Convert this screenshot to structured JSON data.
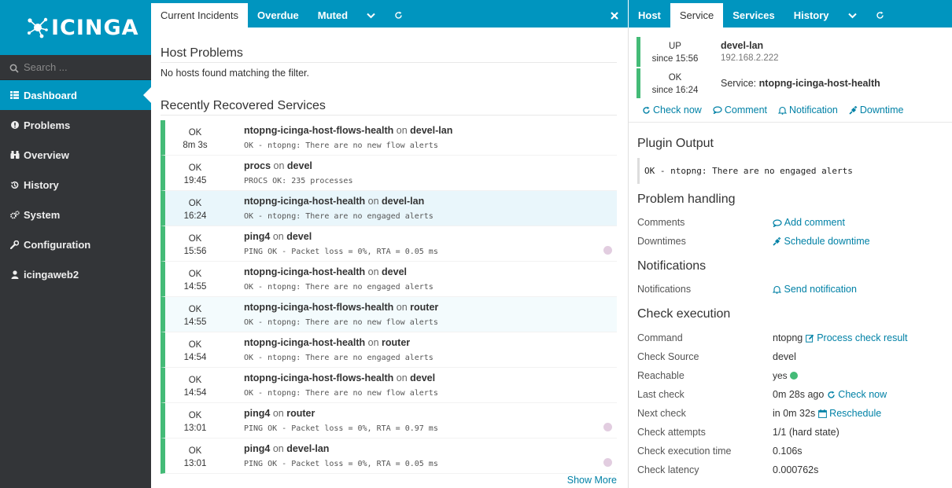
{
  "brand": {
    "name": "ICINGA"
  },
  "search": {
    "placeholder": "Search ..."
  },
  "nav": [
    {
      "label": "Dashboard",
      "icon": "dashboard-icon"
    },
    {
      "label": "Problems",
      "icon": "problems-icon"
    },
    {
      "label": "Overview",
      "icon": "binoculars-icon"
    },
    {
      "label": "History",
      "icon": "history-icon"
    },
    {
      "label": "System",
      "icon": "gears-icon"
    },
    {
      "label": "Configuration",
      "icon": "wrench-icon"
    },
    {
      "label": "icingaweb2",
      "icon": "user-icon"
    }
  ],
  "left_tabs": [
    "Current Incidents",
    "Overdue",
    "Muted"
  ],
  "right_tabs": [
    "Host",
    "Service",
    "Services",
    "History"
  ],
  "host_problems": {
    "title": "Host Problems",
    "empty": "No hosts found matching the filter."
  },
  "recovered": {
    "title": "Recently Recovered Services",
    "on": "on",
    "rows": [
      {
        "state": "OK",
        "time": "8m 3s",
        "service": "ntopng-icinga-host-flows-health",
        "host": "devel-lan",
        "output": "OK - ntopng: There are no new flow alerts"
      },
      {
        "state": "OK",
        "time": "19:45",
        "service": "procs",
        "host": "devel",
        "output": "PROCS OK: 235 processes"
      },
      {
        "state": "OK",
        "time": "16:24",
        "service": "ntopng-icinga-host-health",
        "host": "devel-lan",
        "output": "OK - ntopng: There are no engaged alerts"
      },
      {
        "state": "OK",
        "time": "15:56",
        "service": "ping4",
        "host": "devel",
        "output": "PING OK - Packet loss = 0%, RTA = 0.05 ms"
      },
      {
        "state": "OK",
        "time": "14:55",
        "service": "ntopng-icinga-host-health",
        "host": "devel",
        "output": "OK - ntopng: There are no engaged alerts"
      },
      {
        "state": "OK",
        "time": "14:55",
        "service": "ntopng-icinga-host-flows-health",
        "host": "router",
        "output": "OK - ntopng: There are no new flow alerts"
      },
      {
        "state": "OK",
        "time": "14:54",
        "service": "ntopng-icinga-host-health",
        "host": "router",
        "output": "OK - ntopng: There are no engaged alerts"
      },
      {
        "state": "OK",
        "time": "14:54",
        "service": "ntopng-icinga-host-flows-health",
        "host": "devel",
        "output": "OK - ntopng: There are no new flow alerts"
      },
      {
        "state": "OK",
        "time": "13:01",
        "service": "ping4",
        "host": "router",
        "output": "PING OK - Packet loss = 0%, RTA = 0.97 ms"
      },
      {
        "state": "OK",
        "time": "13:01",
        "service": "ping4",
        "host": "devel-lan",
        "output": "PING OK - Packet loss = 0%, RTA = 0.05 ms"
      }
    ],
    "show_more": "Show More"
  },
  "detail": {
    "host": {
      "state": "UP",
      "since": "since 15:56",
      "name": "devel-lan",
      "address": "192.168.2.222"
    },
    "service": {
      "state": "OK",
      "since": "since 16:24",
      "prefix": "Service:",
      "name": "ntopng-icinga-host-health"
    },
    "actions": [
      "Check now",
      "Comment",
      "Notification",
      "Downtime"
    ],
    "plugin_output": {
      "title": "Plugin Output",
      "text": "OK - ntopng: There are no engaged alerts"
    },
    "problem_handling": {
      "title": "Problem handling",
      "comments_label": "Comments",
      "comments_action": "Add comment",
      "downtimes_label": "Downtimes",
      "downtimes_action": "Schedule downtime"
    },
    "notifications": {
      "title": "Notifications",
      "label": "Notifications",
      "action": "Send notification"
    },
    "check_execution": {
      "title": "Check execution",
      "command_label": "Command",
      "command_value": "ntopng",
      "command_action": "Process check result",
      "source_label": "Check Source",
      "source_value": "devel",
      "reachable_label": "Reachable",
      "reachable_value": "yes",
      "last_label": "Last check",
      "last_value": "0m 28s ago",
      "last_action": "Check now",
      "next_label": "Next check",
      "next_value": "in 0m 32s",
      "next_action": "Reschedule",
      "attempts_label": "Check attempts",
      "attempts_value": "1/1 (hard state)",
      "exec_time_label": "Check execution time",
      "exec_time_value": "0.106s",
      "latency_label": "Check latency",
      "latency_value": "0.000762s"
    }
  },
  "colors": {
    "brand": "#0095bf",
    "sidebar": "#333538",
    "ok": "#44bb77",
    "link": "#0081a6"
  }
}
